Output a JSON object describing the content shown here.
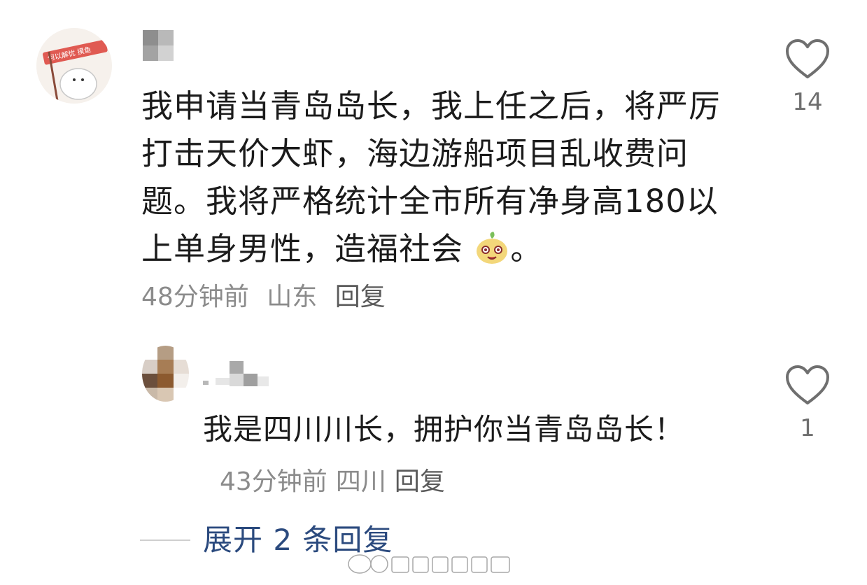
{
  "comment": {
    "text": "我申请当青岛岛长，我上任之后，将严厉打击天价大虾，海边游船项目乱收费问题。我将严格统计全市所有净身高180以上单身男性，造福社会",
    "text_tail": "。",
    "emoji": "smiling-mascot-emoji",
    "avatar_banner": "何以解忧  摸鱼",
    "time": "48分钟前",
    "location": "山东",
    "reply_label": "回复",
    "like_count": "14"
  },
  "reply": {
    "text": "我是四川川长，拥护你当青岛岛长！",
    "time": "43分钟前",
    "location": "四川",
    "reply_label": "回复",
    "like_count": "1"
  },
  "expand": {
    "label": "展开 2 条回复"
  },
  "colors": {
    "meta_gray": "#8b8b8b",
    "link_blue": "#2b4a7e",
    "icon_gray": "#6f6f6f"
  }
}
